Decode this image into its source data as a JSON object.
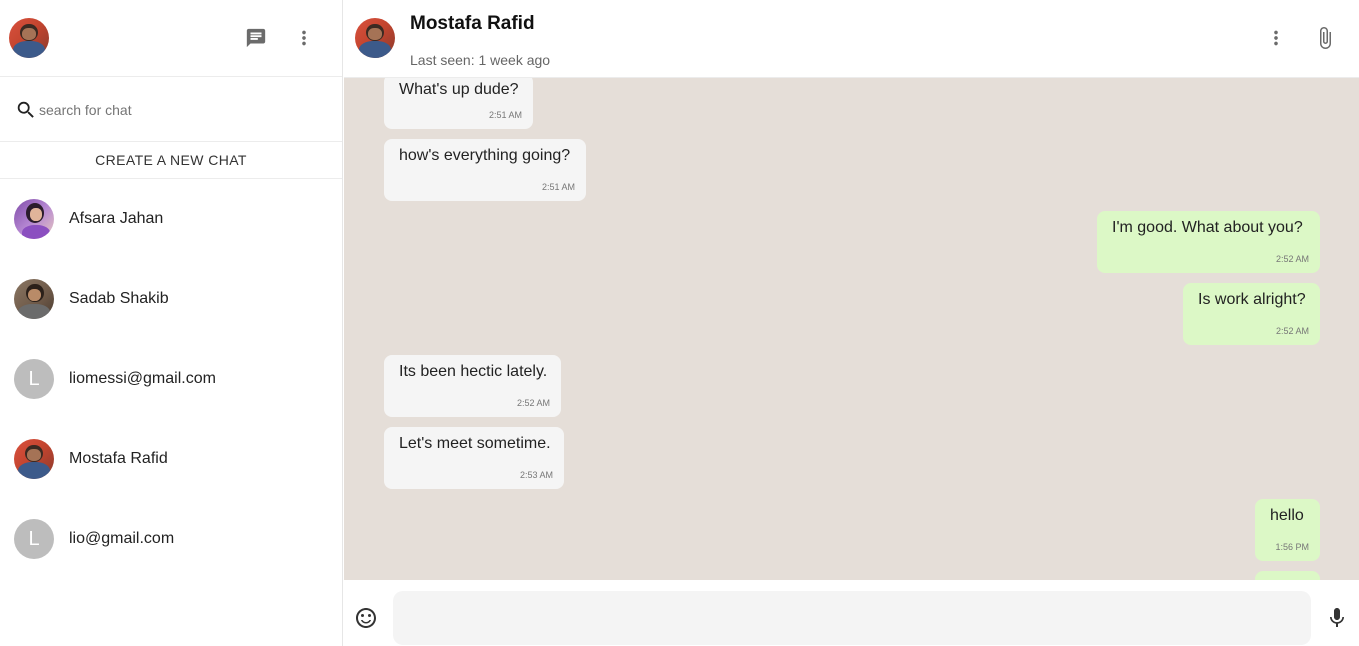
{
  "sidebar": {
    "search_placeholder": "search for chat",
    "create_chat_label": "CREATE A NEW CHAT",
    "chats": [
      {
        "name": "Afsara Jahan",
        "avatar": "photo"
      },
      {
        "name": "Sadab Shakib",
        "avatar": "photo"
      },
      {
        "name": "liomessi@gmail.com",
        "avatar": "letter",
        "initial": "L"
      },
      {
        "name": "Mostafa Rafid",
        "avatar": "photo"
      },
      {
        "name": "lio@gmail.com",
        "avatar": "letter",
        "initial": "L"
      }
    ],
    "icons": [
      "chat-icon",
      "more-vert-icon",
      "search-icon"
    ]
  },
  "chat": {
    "title": "Mostafa Rafid",
    "status": "Last seen: 1 week ago",
    "icons": [
      "more-vert-icon",
      "attach-icon",
      "emoji-icon",
      "mic-icon"
    ],
    "composer_value": "",
    "messages": [
      {
        "text": "What's up dude?",
        "time": "2:51 AM",
        "direction": "in"
      },
      {
        "text": "how's everything going?",
        "time": "2:51 AM",
        "direction": "in"
      },
      {
        "text": "I'm good. What about you?",
        "time": "2:52 AM",
        "direction": "out"
      },
      {
        "text": "Is work alright?",
        "time": "2:52 AM",
        "direction": "out"
      },
      {
        "text": "Its been hectic lately.",
        "time": "2:52 AM",
        "direction": "in"
      },
      {
        "text": "Let's meet sometime.",
        "time": "2:53 AM",
        "direction": "in"
      },
      {
        "text": "hello",
        "time": "1:56 PM",
        "direction": "out"
      }
    ]
  },
  "colors": {
    "chat_background": "#e5ded8",
    "incoming_bubble": "#f5f5f5",
    "outgoing_bubble": "#dcf8c6",
    "letter_avatar": "#bdbdbd"
  }
}
